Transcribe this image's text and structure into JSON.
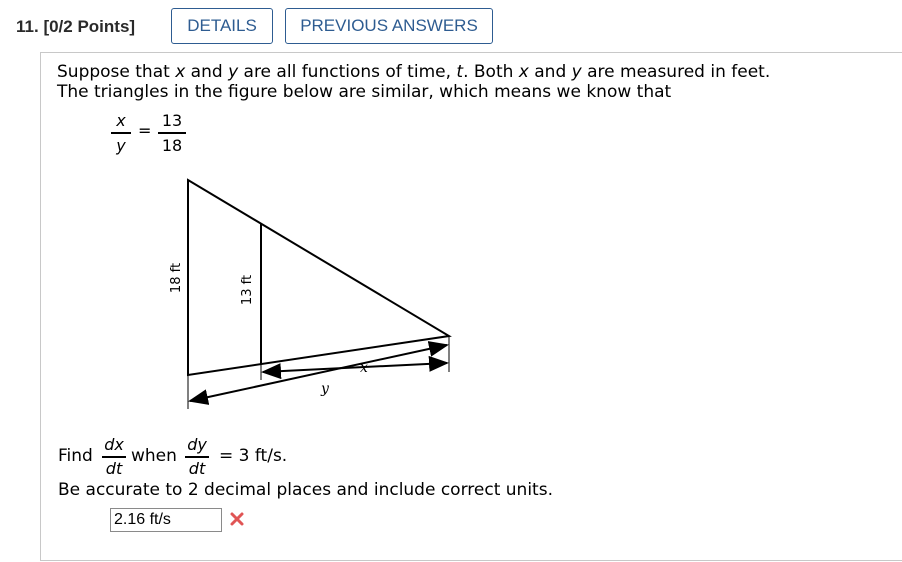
{
  "question": {
    "number": "11.",
    "points": "[0/2 Points]"
  },
  "buttons": {
    "details": "DETAILS",
    "previous_answers": "PREVIOUS ANSWERS"
  },
  "problem": {
    "line1_pre": "Suppose that ",
    "line1_x": "x",
    "line1_and": " and ",
    "line1_y": "y",
    "line1_mid": " are all functions of time, ",
    "line1_t": "t",
    "line1_both": ". Both ",
    "line1_x2": "x",
    "line1_and2": " and ",
    "line1_y2": "y",
    "line1_end": " are measured in feet.",
    "line2": "The triangles in the figure below are similar, which means we know that",
    "ratio_num_left": "x",
    "ratio_den_left": "y",
    "ratio_eq": "=",
    "ratio_num_right": "13",
    "ratio_den_right": "18"
  },
  "figure": {
    "label_big": "18 ft",
    "label_small": "13 ft",
    "label_x": "x",
    "label_y": "y"
  },
  "find": {
    "find_word": "Find",
    "dx_num": "dx",
    "dx_den": "dt",
    "when_word": "when",
    "dy_num": "dy",
    "dy_den": "dt",
    "eq_value": "= 3 ft/s.",
    "instruction": "Be accurate to 2 decimal places and include correct units."
  },
  "answer": {
    "value": "2.16 ft/s",
    "status": "incorrect",
    "status_color": "#e05555"
  }
}
